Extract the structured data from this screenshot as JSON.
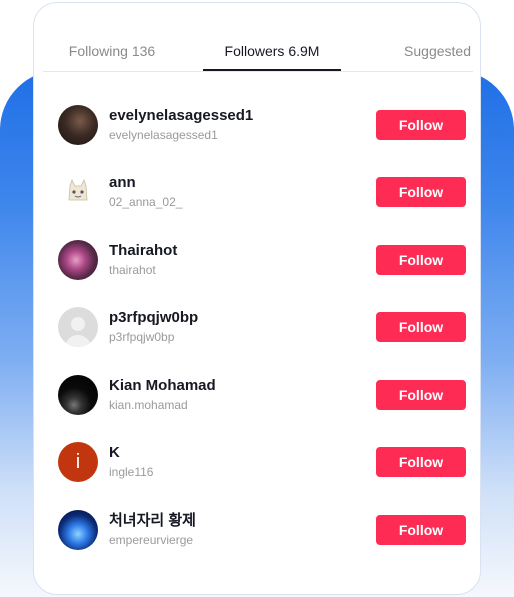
{
  "tabs": [
    {
      "label": "Following 136",
      "active": false
    },
    {
      "label": "Followers 6.9M",
      "active": true
    },
    {
      "label": "Suggested",
      "active": false
    }
  ],
  "colors": {
    "accent": "#fe2c55",
    "background_gradient_top": "#1f6fe6",
    "text_primary": "#161823",
    "text_secondary": "#9a9a9a"
  },
  "followers": [
    {
      "name": "evelynelasagessed1",
      "handle": "evelynelasagessed1",
      "avatar": "photo",
      "button": "Follow"
    },
    {
      "name": "ann",
      "handle": "02_anna_02_",
      "avatar": "anime-character",
      "button": "Follow"
    },
    {
      "name": "Thairahot",
      "handle": "thairahot",
      "avatar": "photo",
      "button": "Follow"
    },
    {
      "name": "p3rfpqjw0bp",
      "handle": "p3rfpqjw0bp",
      "avatar": "default-user",
      "button": "Follow"
    },
    {
      "name": "Kian Mohamad",
      "handle": "kian.mohamad",
      "avatar": "photo",
      "button": "Follow"
    },
    {
      "name": "K",
      "handle": "ingle116",
      "avatar": "letter",
      "avatar_letter": "i",
      "button": "Follow"
    },
    {
      "name": "처녀자리 황제",
      "handle": "empereurvierge",
      "avatar": "photo",
      "button": "Follow"
    }
  ]
}
